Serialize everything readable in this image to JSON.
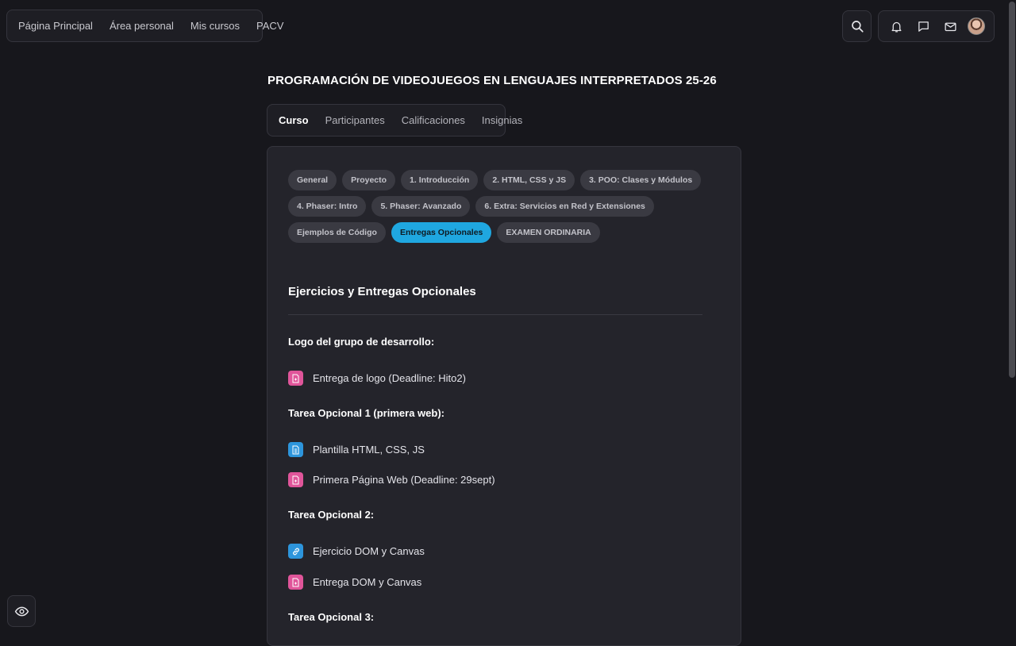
{
  "nav": {
    "items": [
      "Página Principal",
      "Área personal",
      "Mis cursos",
      "PACV"
    ]
  },
  "header_icons": [
    "search-icon",
    "bell-icon",
    "chat-icon",
    "mail-icon",
    "avatar"
  ],
  "course": {
    "title": "PROGRAMACIÓN DE VIDEOJUEGOS EN LENGUAJES INTERPRETADOS 25-26"
  },
  "tabs": [
    "Curso",
    "Participantes",
    "Calificaciones",
    "Insignias"
  ],
  "active_tab": "Curso",
  "sections": [
    "General",
    "Proyecto",
    "1. Introducción",
    "2. HTML, CSS y JS",
    "3. POO: Clases y Módulos",
    "4. Phaser: Intro",
    "5. Phaser: Avanzado",
    "6. Extra: Servicios en Red y Extensiones",
    "Ejemplos de Código",
    "Entregas Opcionales",
    "EXAMEN ORDINARIA"
  ],
  "active_section": "Entregas Opcionales",
  "content": {
    "title": "Ejercicios y Entregas Opcionales",
    "groups": [
      {
        "heading": "Logo del grupo de desarrollo:",
        "activities": [
          {
            "label": "Entrega de logo (Deadline: Hito2)",
            "icon": "assignment-icon",
            "color": "#e0559a"
          }
        ]
      },
      {
        "heading": "Tarea Opcional 1 (primera web):",
        "activities": [
          {
            "label": "Plantilla HTML, CSS, JS",
            "icon": "file-icon",
            "color": "#2d95dc"
          },
          {
            "label": "Primera Página Web (Deadline: 29sept)",
            "icon": "assignment-icon",
            "color": "#e0559a"
          }
        ]
      },
      {
        "heading": "Tarea Opcional 2:",
        "activities": [
          {
            "label": "Ejercicio DOM y Canvas",
            "icon": "link-icon",
            "color": "#2d95dc"
          },
          {
            "label": "Entrega DOM y Canvas",
            "icon": "assignment-icon",
            "color": "#e0559a"
          }
        ]
      },
      {
        "heading": "Tarea Opcional 3:",
        "activities": []
      }
    ]
  },
  "colors": {
    "background": "#17171c",
    "card": "#24242b",
    "accent": "#1fa7e0",
    "assignment": "#e0559a",
    "resource": "#2d95dc"
  }
}
